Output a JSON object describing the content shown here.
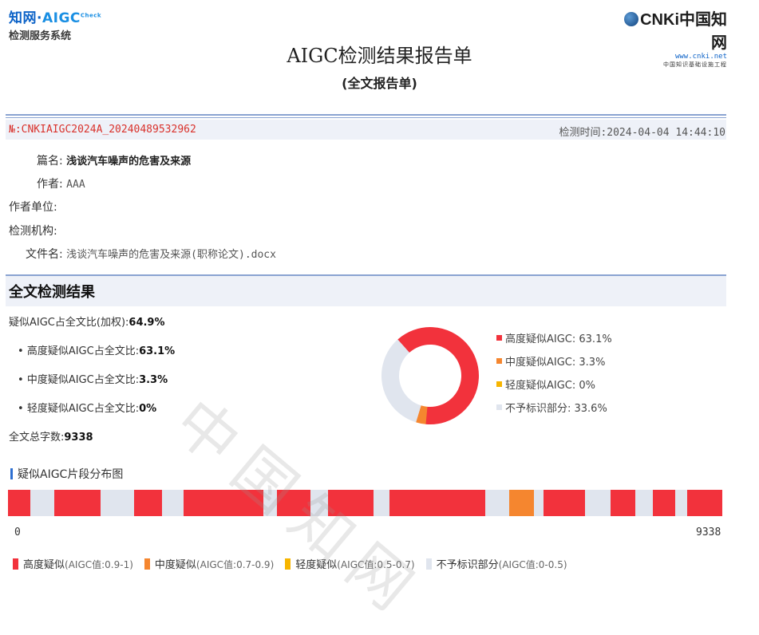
{
  "header": {
    "logo_left_line1_a": "知网·",
    "logo_left_line1_b": "AIGC",
    "logo_left_line1_c": "Check",
    "logo_left_line2": "检测服务系统",
    "logo_right_brand": "CNKi中国知网",
    "logo_right_url": "www.cnki.net",
    "logo_right_project": "中国知识基础设施工程"
  },
  "title": "AIGC检测结果报告单",
  "subtitle": "(全文报告单)",
  "report": {
    "number": "№:CNKIAIGC2024A_20240489532962",
    "check_time_label": "检测时间:",
    "check_time": "2024-04-04 14:44:10"
  },
  "meta": {
    "title_label": "篇名:",
    "title_value": "浅谈汽车噪声的危害及来源",
    "author_label": "作者:",
    "author_value": "AAA",
    "affiliation_label": "作者单位:",
    "affiliation_value": "",
    "institution_label": "检测机构:",
    "institution_value": "",
    "file_label": "文件名:",
    "file_value": "浅谈汽车噪声的危害及来源(职称论文).docx"
  },
  "section_title": "全文检测结果",
  "stats": {
    "weighted_label": "疑似AIGC占全文比(加权):",
    "weighted_value": "64.9%",
    "high_label": "高度疑似AIGC占全文比:",
    "high_value": "63.1%",
    "mid_label": "中度疑似AIGC占全文比:",
    "mid_value": "3.3%",
    "low_label": "轻度疑似AIGC占全文比:",
    "low_value": "0%",
    "total_label": "全文总字数:",
    "total_value": "9338"
  },
  "colors": {
    "high": "#f2323c",
    "mid": "#f5862f",
    "low": "#f7b500",
    "none": "#e0e5ee",
    "accent": "#2d6fd1"
  },
  "chart_data": {
    "type": "pie",
    "values": [
      63.1,
      3.3,
      0,
      33.6
    ],
    "categories": [
      "高度疑似AIGC",
      "中度疑似AIGC",
      "轻度疑似AIGC",
      "不予标识部分"
    ],
    "legend_labels": [
      "高度疑似AIGC: 63.1%",
      "中度疑似AIGC: 3.3%",
      "轻度疑似AIGC: 0%",
      "不予标识部分: 33.6%"
    ]
  },
  "distribution": {
    "title": "疑似AIGC片段分布图",
    "axis_start": "0",
    "axis_end": "9338",
    "total": 9338,
    "segments": [
      {
        "start": 0,
        "end": 290,
        "level": "high"
      },
      {
        "start": 600,
        "end": 1210,
        "level": "high"
      },
      {
        "start": 1650,
        "end": 2010,
        "level": "high"
      },
      {
        "start": 2300,
        "end": 3340,
        "level": "high"
      },
      {
        "start": 3520,
        "end": 3950,
        "level": "high"
      },
      {
        "start": 4180,
        "end": 4780,
        "level": "high"
      },
      {
        "start": 4990,
        "end": 6240,
        "level": "high"
      },
      {
        "start": 6550,
        "end": 6880,
        "level": "mid"
      },
      {
        "start": 7000,
        "end": 7540,
        "level": "high"
      },
      {
        "start": 7880,
        "end": 8200,
        "level": "high"
      },
      {
        "start": 8430,
        "end": 8720,
        "level": "high"
      },
      {
        "start": 8880,
        "end": 9338,
        "level": "high"
      }
    ],
    "legend": [
      {
        "label": "高度疑似",
        "range": "(AIGC值:0.9-1)",
        "color_key": "high"
      },
      {
        "label": "中度疑似",
        "range": "(AIGC值:0.7-0.9)",
        "color_key": "mid"
      },
      {
        "label": "轻度疑似",
        "range": "(AIGC值:0.5-0.7)",
        "color_key": "low"
      },
      {
        "label": "不予标识部分",
        "range": "(AIGC值:0-0.5)",
        "color_key": "none"
      }
    ]
  },
  "watermark": "中国知网"
}
